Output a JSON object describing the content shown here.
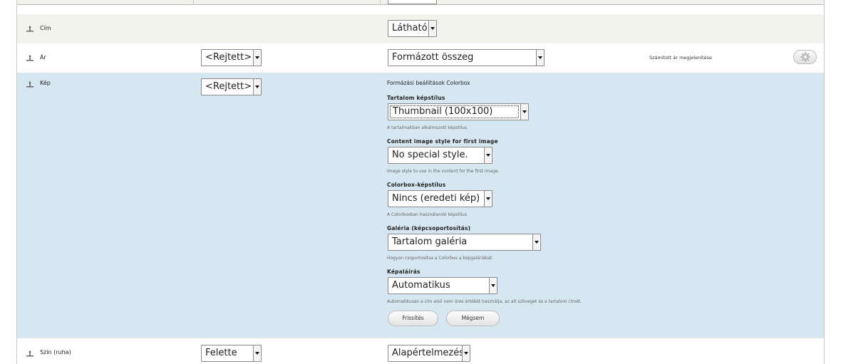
{
  "rows": {
    "title": {
      "label": "Cím",
      "format_value": "Látható"
    },
    "price": {
      "label": "Ár",
      "label_value": "<Rejtett>",
      "format_value": "Formázott összeg",
      "summary": "Számított ár megjelenítése"
    },
    "image": {
      "label": "Kép",
      "label_value": "<Rejtett>",
      "form_title": "Formázási beállítások Colorbox",
      "content_style": {
        "label": "Tartalom képstílus",
        "value": "Thumbnail (100x100)",
        "description": "A tartalmakban alkalmazott képstílus."
      },
      "first_image_style": {
        "label": "Content image style for first image",
        "value": "No special style.",
        "description": "Image style to use in the content for the first image."
      },
      "colorbox_style": {
        "label": "Colorbox-képstílus",
        "value": "Nincs (eredeti kép)",
        "description": "A Colorboxban használandó képstílus."
      },
      "gallery": {
        "label": "Galéria (képcsoportosítás)",
        "value": "Tartalom galéria",
        "description": "Hogyan csoportosítsa a Colorbox a képgalériákat."
      },
      "caption": {
        "label": "Képaláírás",
        "value": "Automatikus",
        "description": "Automatikusan a cím első nem üres értékét használja, az alt szöveget és a tartalom címét."
      },
      "update_button": "Frissítés",
      "cancel_button": "Mégsem"
    },
    "color": {
      "label": "Szín (ruha)",
      "label_value": "Felette",
      "format_value": "Alapértelmezés"
    }
  }
}
